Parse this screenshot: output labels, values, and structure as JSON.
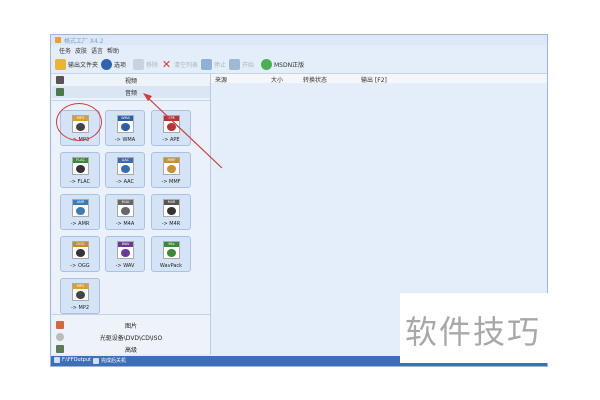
{
  "window": {
    "title": "格式工厂 X4.2"
  },
  "menu": {
    "items": [
      "任务",
      "皮肤",
      "语言",
      "帮助"
    ]
  },
  "toolbar": {
    "output_folder": "输出文件夹",
    "options": "选项",
    "remove": "移除",
    "clear": "清空列表",
    "stop": "停止",
    "start": "开始",
    "website": "MSDN正版"
  },
  "categories": {
    "video": "视频",
    "audio": "音频",
    "image": "图片",
    "disc": "光驱设备\\DVD\\CD\\ISO",
    "advanced": "高级"
  },
  "tiles": [
    {
      "tag": "MP3",
      "label": "-> MP3",
      "color": "#d8a030",
      "glyph": "#444"
    },
    {
      "tag": "WMA",
      "label": "-> WMA",
      "color": "#2c5fa8",
      "glyph": "#2c5fa8"
    },
    {
      "tag": "APE",
      "label": "-> APE",
      "color": "#b33",
      "glyph": "#b33"
    },
    {
      "tag": "FLAC",
      "label": "-> FLAC",
      "color": "#3a8a3a",
      "glyph": "#333"
    },
    {
      "tag": "AAC",
      "label": "-> AAC",
      "color": "#3a6ab5",
      "glyph": "#3a6ab5"
    },
    {
      "tag": "MMF",
      "label": "-> MMF",
      "color": "#c89030",
      "glyph": "#c89030"
    },
    {
      "tag": "AMR",
      "label": "-> AMR",
      "color": "#3a7ab5",
      "glyph": "#3a7ab5"
    },
    {
      "tag": "M4A",
      "label": "-> M4A",
      "color": "#666",
      "glyph": "#666"
    },
    {
      "tag": "M4R",
      "label": "-> M4R",
      "color": "#555",
      "glyph": "#333"
    },
    {
      "tag": "OGG",
      "label": "-> OGG",
      "color": "#c88a30",
      "glyph": "#333"
    },
    {
      "tag": "WAV",
      "label": "-> WAV",
      "color": "#6a3a9a",
      "glyph": "#6a3a9a"
    },
    {
      "tag": "Mix",
      "label": "WavPack",
      "color": "#3a8a3a",
      "glyph": "#3a8a3a"
    },
    {
      "tag": "MP2",
      "label": "-> MP2",
      "color": "#d8a030",
      "glyph": "#444"
    }
  ],
  "list_header": {
    "source": "来源",
    "size": "大小",
    "status": "转换状态",
    "output": "输出 [F2]"
  },
  "statusbar": {
    "output_path": "F:\\FFOutput",
    "shutdown": "完成后关机"
  },
  "watermark": "软件技巧",
  "colors": {
    "accent": "#3d6fb6",
    "annotation": "#d43a3a"
  }
}
